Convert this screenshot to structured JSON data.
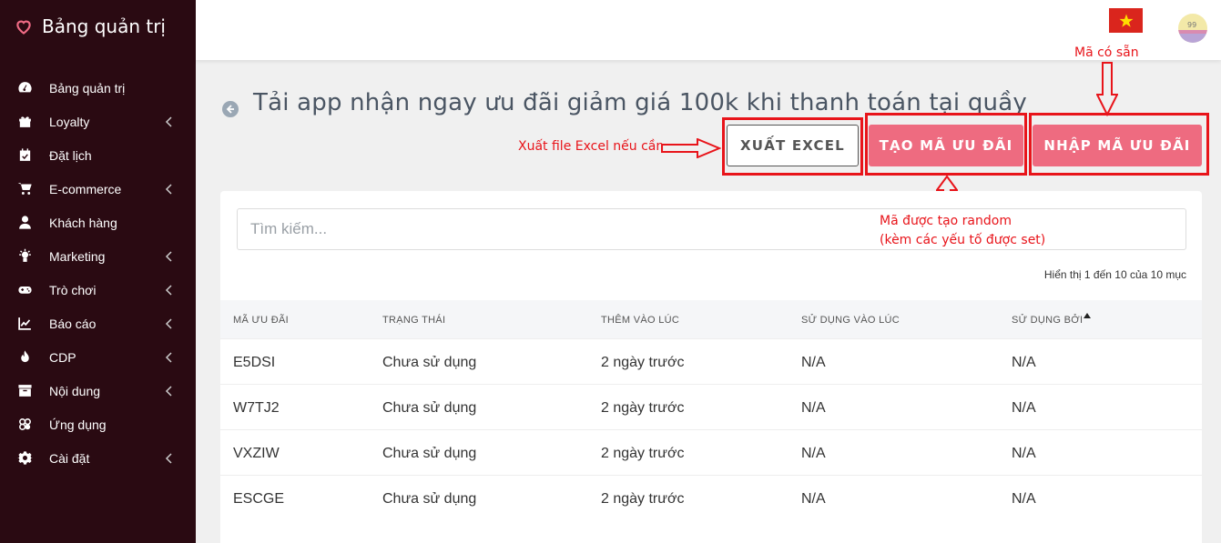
{
  "brand": {
    "title": "Bảng quản trị"
  },
  "sidebar": {
    "items": [
      {
        "label": "Bảng quản trị",
        "icon": "dashboard-icon",
        "chevron": false
      },
      {
        "label": "Loyalty",
        "icon": "gift-icon",
        "chevron": true
      },
      {
        "label": "Đặt lịch",
        "icon": "calendar-icon",
        "chevron": false
      },
      {
        "label": "E-commerce",
        "icon": "cart-icon",
        "chevron": true
      },
      {
        "label": "Khách hàng",
        "icon": "user-icon",
        "chevron": false
      },
      {
        "label": "Marketing",
        "icon": "bulb-icon",
        "chevron": true
      },
      {
        "label": "Trò chơi",
        "icon": "gamepad-icon",
        "chevron": true
      },
      {
        "label": "Báo cáo",
        "icon": "chart-icon",
        "chevron": true
      },
      {
        "label": "CDP",
        "icon": "fire-icon",
        "chevron": true
      },
      {
        "label": "Nội dung",
        "icon": "archive-icon",
        "chevron": true
      },
      {
        "label": "Ứng dụng",
        "icon": "apps-icon",
        "chevron": false
      },
      {
        "label": "Cài đặt",
        "icon": "gear-icon",
        "chevron": true
      }
    ]
  },
  "page": {
    "title": "Tải app nhận ngay ưu đãi giảm giá 100k khi thanh toán tại quầy"
  },
  "toolbar": {
    "export_label": "XUẤT EXCEL",
    "create_label": "TẠO MÃ ƯU ĐÃI",
    "import_label": "NHẬP MÃ ƯU ĐÃI"
  },
  "annotations": {
    "export_note": "Xuất file Excel nếu cần",
    "import_note": "Mã có sẵn",
    "create_note_1": "Mã được tạo random",
    "create_note_2": "(kèm các yếu tố được set)"
  },
  "search": {
    "placeholder": "Tìm kiếm..."
  },
  "table": {
    "showing": "Hiển thị 1 đến 10 của 10 mục",
    "columns": [
      "MÃ ƯU ĐÃI",
      "TRẠNG THÁI",
      "THÊM VÀO LÚC",
      "SỬ DỤNG VÀO LÚC",
      "SỬ DỤNG BỞI"
    ],
    "rows": [
      [
        "E5DSI",
        "Chưa sử dụng",
        "2 ngày trước",
        "N/A",
        "N/A"
      ],
      [
        "W7TJ2",
        "Chưa sử dụng",
        "2 ngày trước",
        "N/A",
        "N/A"
      ],
      [
        "VXZIW",
        "Chưa sử dụng",
        "2 ngày trước",
        "N/A",
        "N/A"
      ],
      [
        "ESCGE",
        "Chưa sử dụng",
        "2 ngày trước",
        "N/A",
        "N/A"
      ]
    ]
  },
  "colors": {
    "sidebar": "#2a0a12",
    "accent": "#ee6b80",
    "annotation": "#e8141a"
  }
}
